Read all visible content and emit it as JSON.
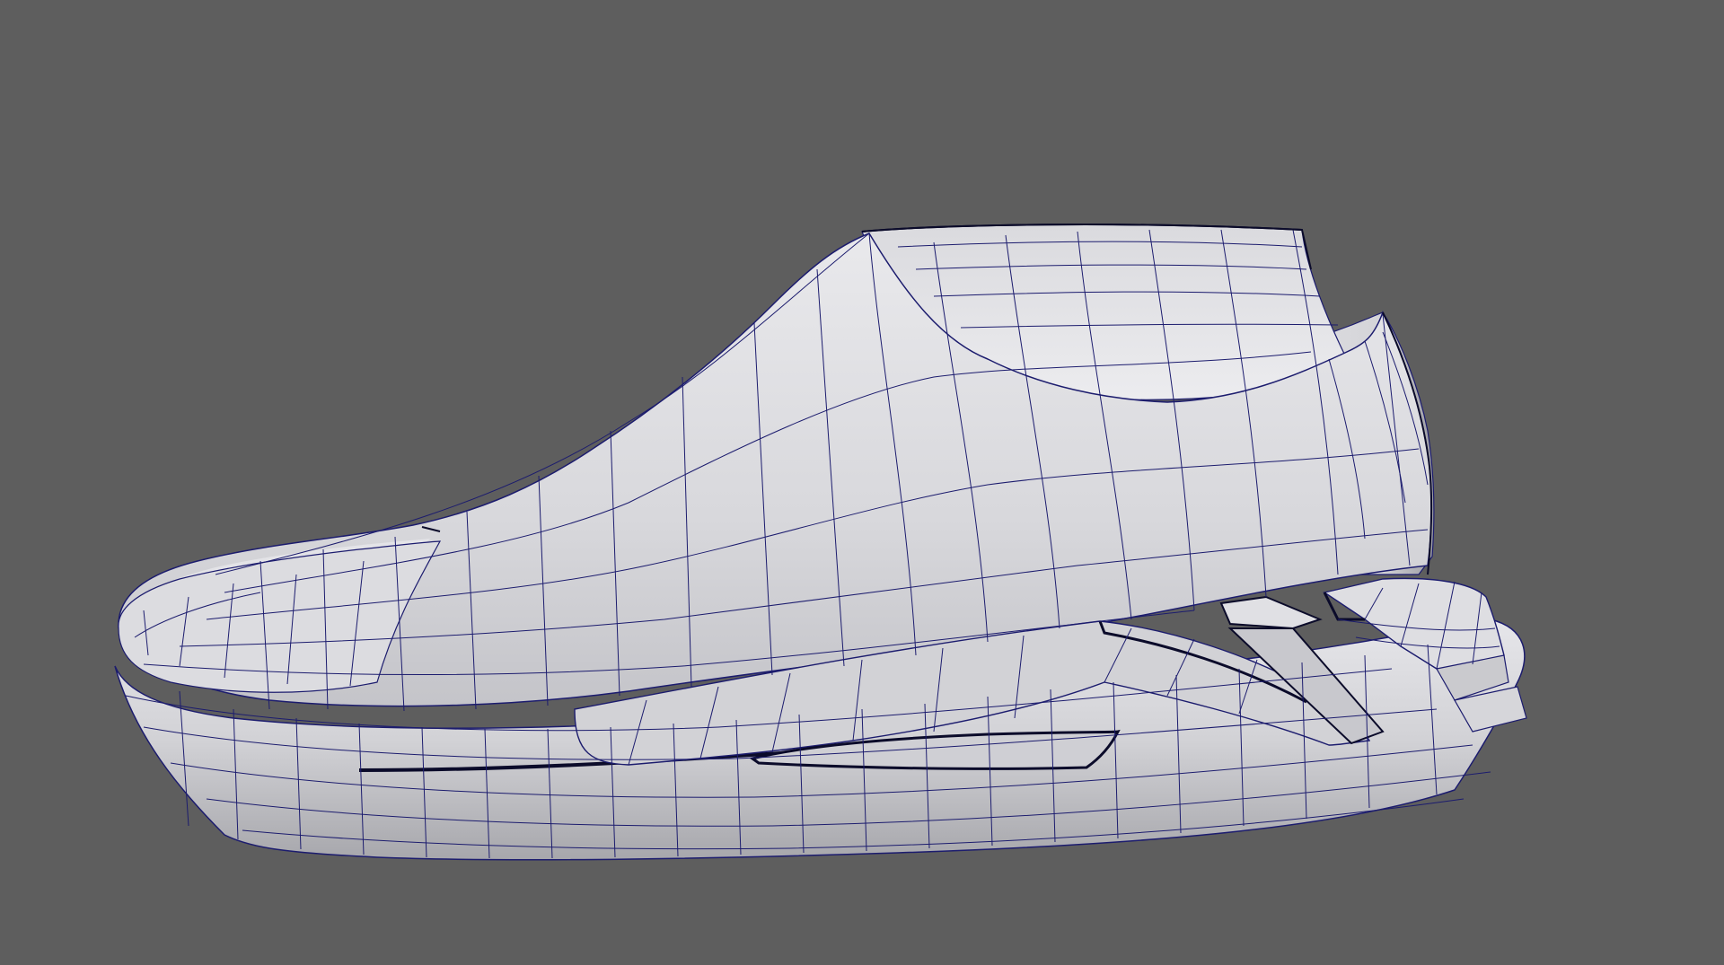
{
  "viewport": {
    "background_color": "#5e5e5e",
    "shading_mode": "wireframe-on-shaded"
  },
  "model": {
    "object": "shoe-mesh",
    "surface_color": "#d6d6d8",
    "highlight_color": "#eeeef0",
    "shadow_color": "#a9a9ad",
    "wire_color": "#1c1c6e",
    "edge_color": "#0b0b2a"
  }
}
